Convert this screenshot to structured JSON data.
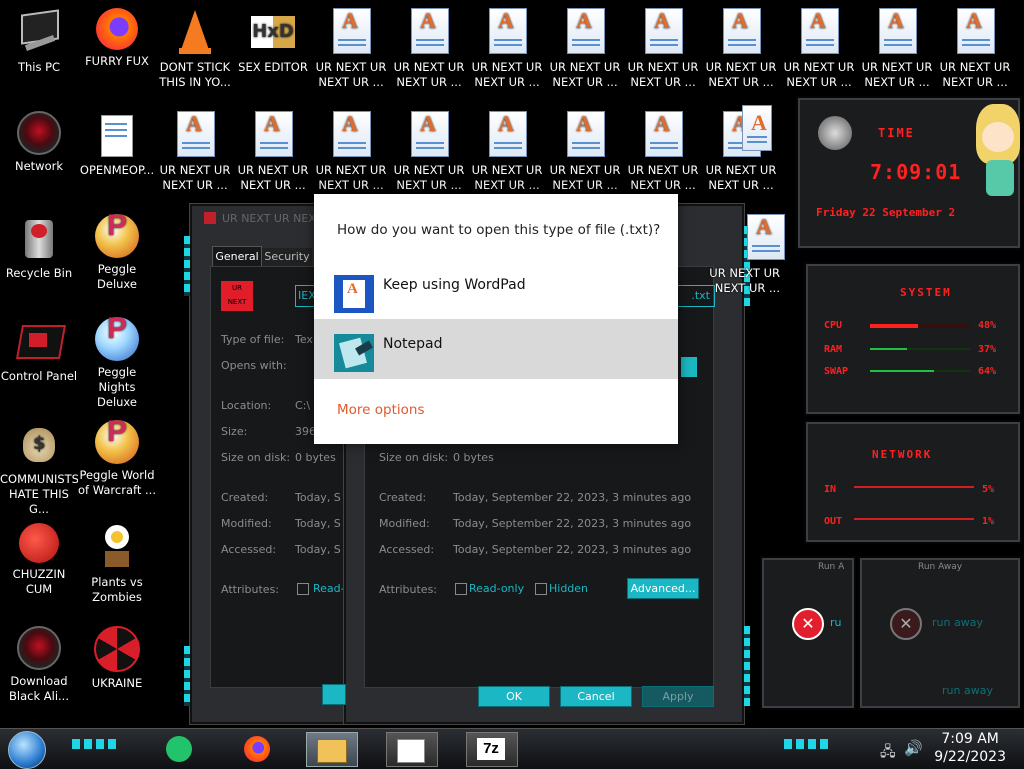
{
  "desktop": {
    "col1": [
      {
        "label": "This PC"
      },
      {
        "label": "Network"
      },
      {
        "label": "Recycle Bin"
      },
      {
        "label": "Control Panel"
      },
      {
        "label": "COMMUNISTS HATE THIS G..."
      },
      {
        "label": "CHUZZIN CUM"
      },
      {
        "label": "Download Black Ali..."
      }
    ],
    "col2": [
      {
        "label": "FURRY FUX"
      },
      {
        "label": "OPENMEOP..."
      },
      {
        "label": "Peggle Deluxe"
      },
      {
        "label": "Peggle Nights Deluxe"
      },
      {
        "label": "Peggle World of Warcraft ..."
      },
      {
        "label": "Plants vs Zombies"
      },
      {
        "label": "UKRAINE"
      }
    ],
    "row1_extra": [
      {
        "label": "DONT STICK THIS IN YO..."
      },
      {
        "label": "SEX EDITOR"
      }
    ],
    "doc_label": "UR NEXT UR NEXT UR ...",
    "doc_label_short": "UR NEXT UR NEXT UR ...",
    "partial_labels": [
      "UR N",
      "NEX"
    ]
  },
  "prop_window_left": {
    "title": "UR NEXT UR NEX",
    "tabs": [
      "General",
      "Security"
    ],
    "file_badge": [
      "UR",
      "NEXT"
    ],
    "name_partial": "IEX",
    "rows": [
      {
        "label": "Type of file:",
        "value": "Tex"
      },
      {
        "label": "Opens with:",
        "value": ""
      },
      {
        "label": "Location:",
        "value": "C:\\"
      },
      {
        "label": "Size:",
        "value": "396"
      },
      {
        "label": "Size on disk:",
        "value": "0 bytes"
      },
      {
        "label": "Created:",
        "value": "Today, S"
      },
      {
        "label": "Modified:",
        "value": "Today, S"
      },
      {
        "label": "Accessed:",
        "value": "Today, S"
      },
      {
        "label": "Attributes:",
        "value": "Read-"
      }
    ]
  },
  "prop_window_right": {
    "name_partial": ".txt",
    "size_on_disk_label": "Size on disk:",
    "size_on_disk_value": "0 bytes",
    "created_label": "Created:",
    "created_value": "Today, September 22, 2023, 3 minutes ago",
    "modified_label": "Modified:",
    "modified_value": "Today, September 22, 2023, 3 minutes ago",
    "accessed_label": "Accessed:",
    "accessed_value": "Today, September 22, 2023, 3 minutes ago",
    "attributes_label": "Attributes:",
    "readonly_label": "Read-only",
    "hidden_label": "Hidden",
    "advanced_label": "Advanced...",
    "ok_label": "OK",
    "cancel_label": "Cancel",
    "apply_label": "Apply"
  },
  "open_with_dialog": {
    "question": "How do you want to open this type of file (.txt)?",
    "option1": "Keep using WordPad",
    "option2": "Notepad",
    "more": "More options"
  },
  "gadget": {
    "time_title": "TIME",
    "time_value": "7:09:01",
    "date_value": "Friday 22 September 2",
    "system_title": "SYSTEM",
    "cpu_label": "CPU",
    "cpu_value": "48%",
    "cpu_fraction": 0.48,
    "ram_label": "RAM",
    "ram_value": "37%",
    "ram_fraction": 0.37,
    "swap_label": "SWAP",
    "swap_value": "64%",
    "swap_fraction": 0.64,
    "network_title": "NETWORK",
    "in_label": "IN",
    "in_value": "5%",
    "out_label": "OUT",
    "out_value": "1%"
  },
  "error_popups": {
    "title_partial": "Run A",
    "title2": "Run Away",
    "msg_partial": "ru",
    "msg": "run away",
    "msg2": "run away"
  },
  "taskbar": {
    "time": "7:09 AM",
    "date": "9/22/2023",
    "seven_zip": "7z"
  },
  "colors": {
    "accent_cyan": "#1bb7c4",
    "alien_red": "#ff2020",
    "link_orange": "#e1592c"
  }
}
